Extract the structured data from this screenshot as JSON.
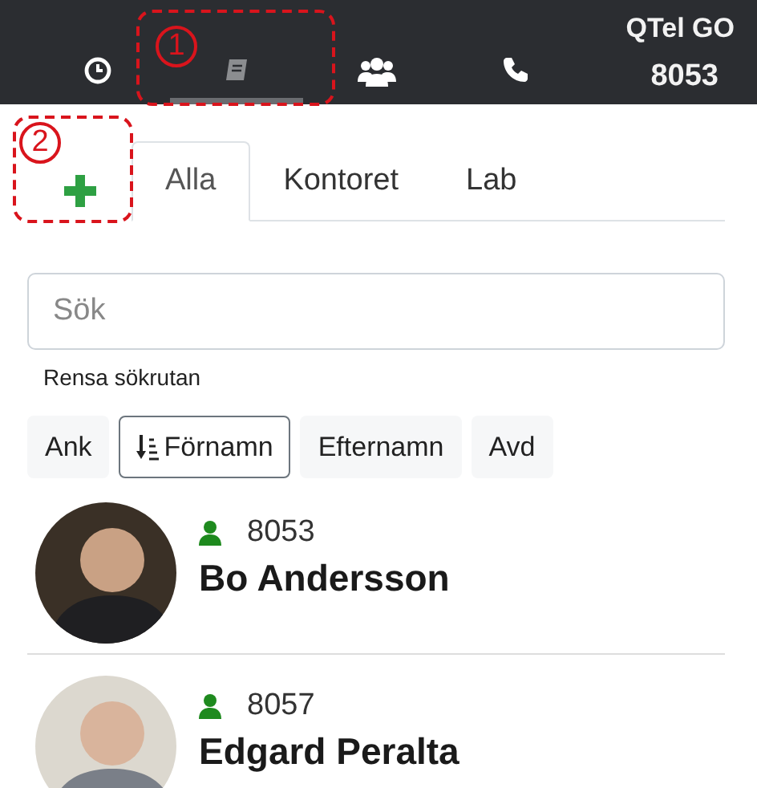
{
  "nav": {
    "items": [
      {
        "kind": "clock",
        "selected": false
      },
      {
        "kind": "book",
        "selected": true
      },
      {
        "kind": "users",
        "selected": false
      },
      {
        "kind": "phone",
        "selected": false
      }
    ],
    "app_name": "QTel GO",
    "extension": "8053"
  },
  "callouts": [
    {
      "label": "1"
    },
    {
      "label": "2"
    }
  ],
  "tabs": [
    {
      "label": "Alla",
      "selected": true
    },
    {
      "label": "Kontoret",
      "selected": false
    },
    {
      "label": "Lab",
      "selected": false
    }
  ],
  "search": {
    "placeholder": "Sök",
    "clear_link": "Rensa sökrutan"
  },
  "sort_buttons": [
    {
      "label": "Ank",
      "selected": false
    },
    {
      "label": "Förnamn",
      "selected": true
    },
    {
      "label": "Efternamn",
      "selected": false
    },
    {
      "label": "Avd",
      "selected": false
    }
  ],
  "contacts": [
    {
      "extension": "8053",
      "name": "Bo Andersson"
    },
    {
      "extension": "8057",
      "name": "Edgard Peralta"
    }
  ]
}
